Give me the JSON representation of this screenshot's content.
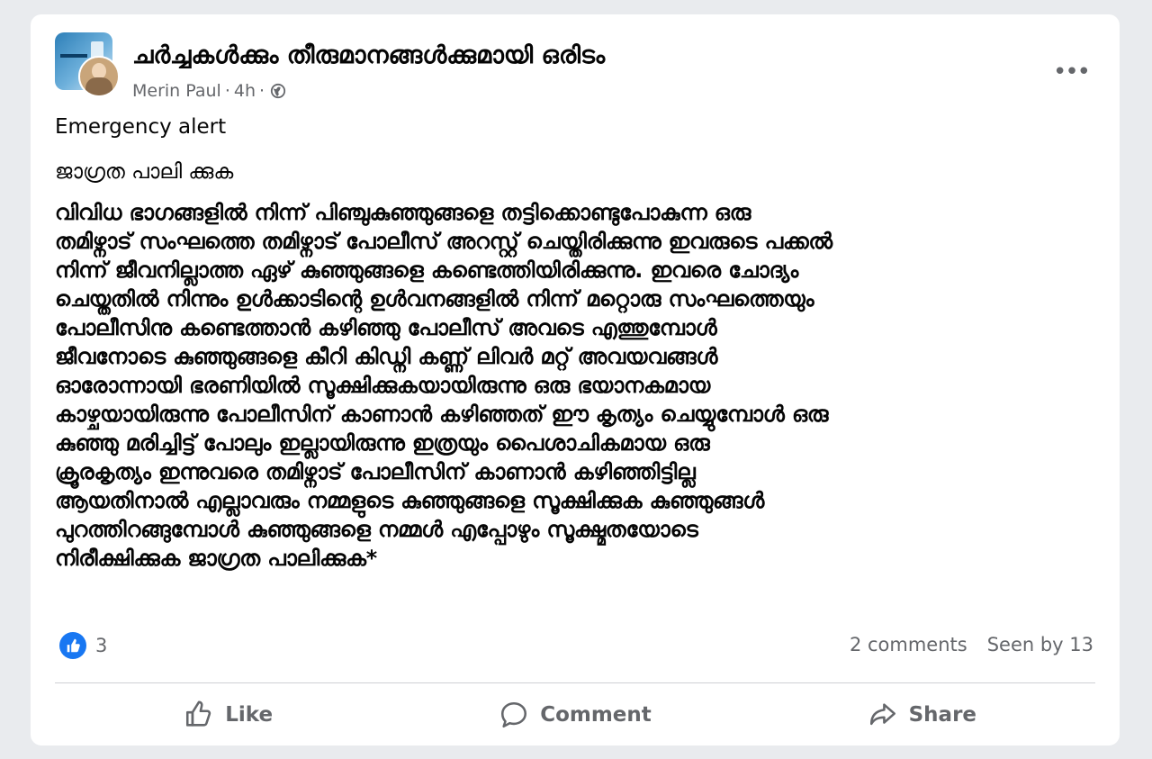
{
  "post": {
    "group_name": "ചർച്ചകൾക്കും തീരുമാനങ്ങൾക്കുമായി ഒരിടം",
    "author": "Merin Paul",
    "separator": "·",
    "time": "4h",
    "privacy_icon": "globe-icon",
    "more_icon": "more-icon",
    "text_line1": "Emergency alert",
    "text_line2": "ജാഗ്രത പാലി ക്കുക",
    "body": " വിവിധ ഭാഗങ്ങളിൽ നിന്ന് പിഞ്ചുകുഞ്ഞുങ്ങളെ തട്ടിക്കൊണ്ടുപോകുന്ന ഒരു\nതമിഴ്നാട് സംഘത്തെ തമിഴ്നാട് പോലീസ് അറസ്റ്റ് ചെയ്തിരിക്കുന്നു ഇവരുടെ പക്കൽ\nനിന്ന് ജീവനില്ലാത്ത ഏഴ് കുഞ്ഞുങ്ങളെ കണ്ടെത്തിയിരിക്കുന്നു. ഇവരെ ചോദ്യം\nചെയ്തതിൽ നിന്നും ഉൾക്കാടിന്റെ ഉൾവനങ്ങളിൽ നിന്ന് മറ്റൊരു സംഘത്തെയും\nപോലീസിനു കണ്ടെത്താൻ കഴിഞ്ഞു പോലീസ് അവടെ എത്തുമ്പോൾ\nജീവനോടെ കുഞ്ഞുങ്ങളെ കീറി കിഡ്നി കണ്ണ് ലിവർ മറ്റ് അവയവങ്ങൾ\nഓരോന്നായി ഭരണിയിൽ സൂക്ഷിക്കുകയായിരുന്നു ഒരു ഭയാനകമായ\nകാഴ്ചയായിരുന്നു പോലീസിന് കാണാൻ കഴിഞ്ഞത് ഈ കൃത്യം ചെയ്യുമ്പോൾ ഒരു\nകുഞ്ഞു മരിച്ചിട്ട് പോലും ഇല്ലായിരുന്നു ഇത്രയും പൈശാചികമായ ഒരു\nക്രൂരകൃത്യം ഇന്നുവരെ തമിഴ്നാട് പോലീസിന് കാണാൻ കഴിഞ്ഞിട്ടില്ല\nആയതിനാൽ എല്ലാവരും നമ്മളുടെ കുഞ്ഞുങ്ങളെ സൂക്ഷിക്കുക കുഞ്ഞുങ്ങൾ\nപുറത്തിറങ്ങുമ്പോൾ കുഞ്ഞുങ്ങളെ നമ്മൾ എപ്പോഴും സൂക്ഷ്മതയോടെ\nനിരീക്ഷിക്കുക ജാഗ്രത പാലിക്കുക*"
  },
  "reactions": {
    "icon": "like-reaction-icon",
    "count": "3",
    "comments": "2 comments",
    "seen_by": "Seen by 13"
  },
  "actions": [
    {
      "label": "Like",
      "icon": "thumbs-up-icon"
    },
    {
      "label": "Comment",
      "icon": "comment-bubble-icon"
    },
    {
      "label": "Share",
      "icon": "share-arrow-icon"
    }
  ],
  "colors": {
    "background": "#e9ebee",
    "card": "#ffffff",
    "secondary_text": "#65676b",
    "like_blue": "#1877f2"
  }
}
